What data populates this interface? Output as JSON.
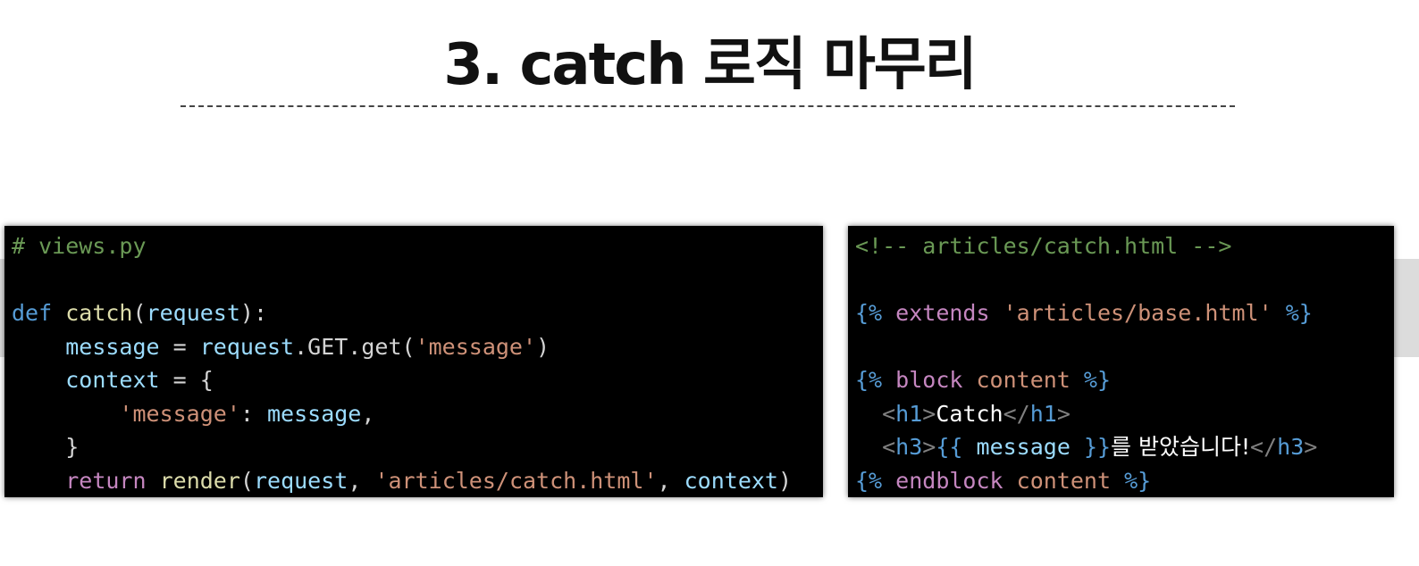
{
  "slide": {
    "title": "3. catch 로직 마무리"
  },
  "python_code": {
    "lines": [
      [
        [
          "comment",
          "# views.py"
        ]
      ],
      [],
      [
        [
          "kw",
          "def"
        ],
        [
          "plain",
          " "
        ],
        [
          "fn",
          "catch"
        ],
        [
          "plain",
          "("
        ],
        [
          "var",
          "request"
        ],
        [
          "plain",
          "):"
        ]
      ],
      [
        [
          "plain",
          "    "
        ],
        [
          "var",
          "message"
        ],
        [
          "plain",
          " = "
        ],
        [
          "var",
          "request"
        ],
        [
          "plain",
          ".GET.get("
        ],
        [
          "str",
          "'message'"
        ],
        [
          "plain",
          ")"
        ]
      ],
      [
        [
          "plain",
          "    "
        ],
        [
          "var",
          "context"
        ],
        [
          "plain",
          " = {"
        ]
      ],
      [
        [
          "plain",
          "        "
        ],
        [
          "str",
          "'message'"
        ],
        [
          "plain",
          ": "
        ],
        [
          "var",
          "message"
        ],
        [
          "plain",
          ","
        ]
      ],
      [
        [
          "plain",
          "    }"
        ]
      ],
      [
        [
          "plain",
          "    "
        ],
        [
          "ctrl",
          "return"
        ],
        [
          "plain",
          " "
        ],
        [
          "fn",
          "render"
        ],
        [
          "plain",
          "("
        ],
        [
          "var",
          "request"
        ],
        [
          "plain",
          ", "
        ],
        [
          "str",
          "'articles/catch.html'"
        ],
        [
          "plain",
          ", "
        ],
        [
          "var",
          "context"
        ],
        [
          "plain",
          ")"
        ]
      ]
    ]
  },
  "html_code": {
    "lines": [
      [
        [
          "comment",
          "<!-- articles/catch.html -->"
        ]
      ],
      [],
      [
        [
          "tpl",
          "{%"
        ],
        [
          "plain",
          " "
        ],
        [
          "ctrl",
          "extends"
        ],
        [
          "plain",
          " "
        ],
        [
          "str",
          "'articles/base.html'"
        ],
        [
          "plain",
          " "
        ],
        [
          "tpl",
          "%}"
        ]
      ],
      [],
      [
        [
          "tpl",
          "{%"
        ],
        [
          "plain",
          " "
        ],
        [
          "ctrl",
          "block"
        ],
        [
          "plain",
          " "
        ],
        [
          "str",
          "content"
        ],
        [
          "plain",
          " "
        ],
        [
          "tpl",
          "%}"
        ]
      ],
      [
        [
          "plain",
          "  "
        ],
        [
          "tag",
          "<"
        ],
        [
          "tagname",
          "h1"
        ],
        [
          "tag",
          ">"
        ],
        [
          "text",
          "Catch"
        ],
        [
          "tag",
          "</"
        ],
        [
          "tagname",
          "h1"
        ],
        [
          "tag",
          ">"
        ]
      ],
      [
        [
          "plain",
          "  "
        ],
        [
          "tag",
          "<"
        ],
        [
          "tagname",
          "h3"
        ],
        [
          "tag",
          ">"
        ],
        [
          "tpl",
          "{{"
        ],
        [
          "plain",
          " "
        ],
        [
          "var",
          "message"
        ],
        [
          "plain",
          " "
        ],
        [
          "tpl",
          "}}"
        ],
        [
          "text",
          "를 받았습니다!"
        ],
        [
          "tag",
          "</"
        ],
        [
          "tagname",
          "h3"
        ],
        [
          "tag",
          ">"
        ]
      ],
      [
        [
          "tpl",
          "{%"
        ],
        [
          "plain",
          " "
        ],
        [
          "ctrl",
          "endblock"
        ],
        [
          "plain",
          " "
        ],
        [
          "str",
          "content"
        ],
        [
          "plain",
          " "
        ],
        [
          "tpl",
          "%}"
        ]
      ]
    ]
  }
}
